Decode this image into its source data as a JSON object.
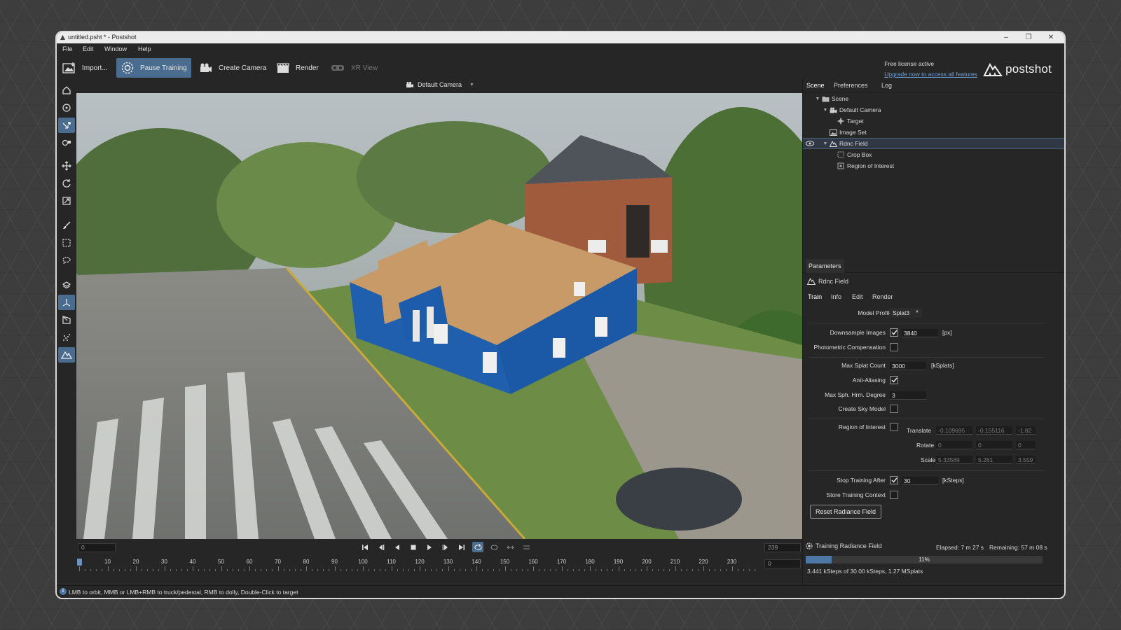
{
  "window": {
    "title": "untitled.psht * - Postshot"
  },
  "menu": [
    "File",
    "Edit",
    "Window",
    "Help"
  ],
  "toolbar": {
    "import": "Import...",
    "pause_training": "Pause Training",
    "create_camera": "Create Camera",
    "render": "Render",
    "xr_view": "XR View"
  },
  "license": {
    "status": "Free license active",
    "upgrade": "Upgrade now to access all features"
  },
  "brand": "postshot",
  "viewport": {
    "camera": "Default Camera"
  },
  "timeline": {
    "start": "0",
    "end": "239",
    "current": "0",
    "ticks": [
      "10",
      "20",
      "30",
      "40",
      "50",
      "60",
      "70",
      "80",
      "90",
      "100",
      "110",
      "120",
      "130",
      "140",
      "150",
      "160",
      "170",
      "180",
      "190",
      "200",
      "210",
      "220",
      "230"
    ]
  },
  "scene_tabs": [
    "Scene",
    "Preferences",
    "Log"
  ],
  "scene_tree": [
    {
      "label": "Scene",
      "depth": 0,
      "expanded": true
    },
    {
      "label": "Default Camera",
      "depth": 1,
      "expanded": true
    },
    {
      "label": "Target",
      "depth": 2
    },
    {
      "label": "Image Set",
      "depth": 1
    },
    {
      "label": "Rdnc Field",
      "depth": 1,
      "expanded": true,
      "selected": true
    },
    {
      "label": "Crop Box",
      "depth": 2
    },
    {
      "label": "Region of Interest",
      "depth": 2
    }
  ],
  "parameters": {
    "title": "Parameters",
    "object": "Rdnc Field",
    "tabs": [
      "Train",
      "Info",
      "Edit",
      "Render"
    ],
    "model_profile_label": "Model Profile",
    "model_profile": "Splat3",
    "downsample_label": "Downsample Images",
    "downsample_checked": true,
    "downsample_value": "3840",
    "downsample_unit": "[px]",
    "photometric_label": "Photometric Compensation",
    "photometric_checked": false,
    "max_splat_label": "Max Splat Count",
    "max_splat_value": "3000",
    "max_splat_unit": "[kSplats]",
    "anti_aliasing_label": "Anti-Aliasing",
    "anti_aliasing_checked": true,
    "max_sph_label": "Max Sph. Hrm. Degree",
    "max_sph_value": "3",
    "sky_model_label": "Create Sky Model",
    "sky_model_checked": false,
    "roi_label": "Region of Interest",
    "roi_checked": false,
    "translate_label": "Translate",
    "translate": [
      "-0.109695",
      "-0.155116",
      "-1.82"
    ],
    "rotate_label": "Rotate",
    "rotate": [
      "0",
      "0",
      "0"
    ],
    "scale_label": "Scale",
    "scale": [
      "5.33569",
      "5.261",
      "3.559"
    ],
    "stop_after_label": "Stop Training After",
    "stop_after_checked": true,
    "stop_after_value": "30",
    "stop_after_unit": "[kSteps]",
    "store_context_label": "Store Training Context",
    "store_context_checked": false,
    "reset_button": "Reset Radiance Field"
  },
  "training": {
    "label": "Training Radiance Field",
    "elapsed": "Elapsed: 7 m 27 s",
    "remaining": "Remaining: 57 m 08 s",
    "progress": 0.11,
    "progress_text": "11%",
    "stats": "3.441 kSteps of 30.00 kSteps, 1.27 MSplats"
  },
  "status": "LMB to orbit, MMB or LMB+RMB to truck/pedestal, RMB to dolly, Double-Click to target",
  "colors": {
    "accent": "#4a6c8e",
    "link": "#6ea0d6",
    "progress": "#4d78a6"
  }
}
